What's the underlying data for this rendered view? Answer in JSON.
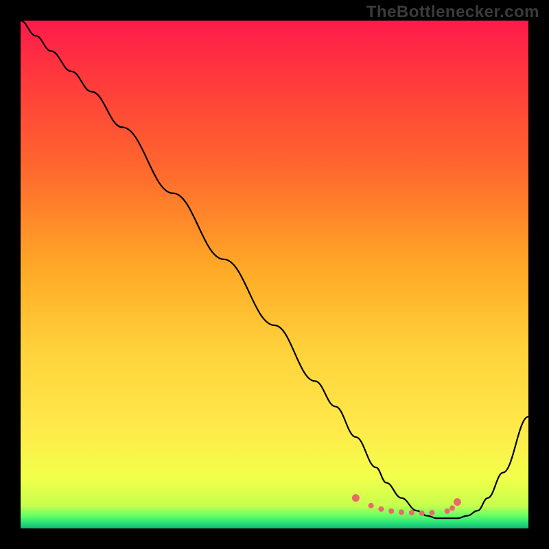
{
  "watermark": "TheBottlenecker.com",
  "chart_data": {
    "type": "line",
    "title": "",
    "xlabel": "",
    "ylabel": "",
    "xlim": [
      0,
      100
    ],
    "ylim": [
      0,
      100
    ],
    "grid": false,
    "legend": "none",
    "series": [
      {
        "name": "bottleneck-curve",
        "x": [
          0,
          3,
          6,
          10,
          14,
          20,
          30,
          40,
          50,
          58,
          62,
          66,
          70,
          72,
          75,
          78,
          80,
          82,
          84,
          86,
          88,
          90,
          92,
          95,
          100
        ],
        "y": [
          100,
          97,
          94,
          90,
          86,
          79,
          66,
          53,
          40,
          29,
          24,
          18,
          12,
          9,
          6,
          3.5,
          2.5,
          2,
          2,
          2,
          2.5,
          3.5,
          6,
          11,
          22
        ]
      }
    ],
    "highlight": {
      "name": "optimal-range-dots",
      "x": [
        66,
        69,
        71,
        73,
        75,
        77,
        79,
        81,
        84,
        85,
        86
      ],
      "y": [
        6,
        4.5,
        3.8,
        3.4,
        3.2,
        3.1,
        3.0,
        3.1,
        3.4,
        4.0,
        5.2
      ]
    },
    "gradient_stops": [
      {
        "offset": 0.0,
        "color": "#ff1a4b"
      },
      {
        "offset": 0.12,
        "color": "#ff3b3b"
      },
      {
        "offset": 0.3,
        "color": "#ff6a2d"
      },
      {
        "offset": 0.48,
        "color": "#ffa726"
      },
      {
        "offset": 0.65,
        "color": "#ffd23a"
      },
      {
        "offset": 0.8,
        "color": "#ffe94a"
      },
      {
        "offset": 0.9,
        "color": "#f2ff4a"
      },
      {
        "offset": 0.955,
        "color": "#c7ff4d"
      },
      {
        "offset": 0.975,
        "color": "#66ff66"
      },
      {
        "offset": 0.99,
        "color": "#22e07a"
      },
      {
        "offset": 1.0,
        "color": "#1db36e"
      }
    ],
    "curve_color": "#000000",
    "dot_color": "#e86a6a"
  }
}
